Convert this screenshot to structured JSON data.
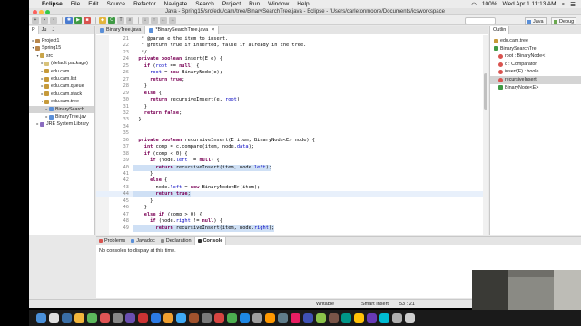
{
  "menubar": {
    "app": "Eclipse",
    "items": [
      "File",
      "Edit",
      "Source",
      "Refactor",
      "Navigate",
      "Search",
      "Project",
      "Run",
      "Window",
      "Help"
    ],
    "battery": "100%",
    "clock": "Wed Apr 1  11:13 AM"
  },
  "window": {
    "title": "Java - Spring15/src/edu/cam/tree/BinarySearchTree.java - Eclipse - /Users/carletonmoore/Documents/icsworkspace"
  },
  "perspectives": [
    "Java",
    "Debug"
  ],
  "explorer": {
    "tabs": [
      "P",
      "Ju",
      "J"
    ],
    "tree": [
      {
        "label": "Project1",
        "depth": 0,
        "icon": "project-icon",
        "color": "#b8864b",
        "twisty": "▸"
      },
      {
        "label": "Spring15",
        "depth": 0,
        "icon": "project-icon",
        "color": "#b8864b",
        "twisty": "▾"
      },
      {
        "label": "src",
        "depth": 1,
        "icon": "source-folder-icon",
        "color": "#c9a54a",
        "twisty": "▾"
      },
      {
        "label": "(default package)",
        "depth": 2,
        "icon": "package-icon",
        "color": "#d8c27a",
        "twisty": "▸"
      },
      {
        "label": "edu.cam",
        "depth": 2,
        "icon": "package-icon",
        "color": "#c69a3a",
        "twisty": "▸"
      },
      {
        "label": "edu.cam.list",
        "depth": 2,
        "icon": "package-icon",
        "color": "#c69a3a",
        "twisty": "▸"
      },
      {
        "label": "edu.cam.queue",
        "depth": 2,
        "icon": "package-icon",
        "color": "#c69a3a",
        "twisty": "▸"
      },
      {
        "label": "edu.cam.stack",
        "depth": 2,
        "icon": "package-icon",
        "color": "#c69a3a",
        "twisty": "▸"
      },
      {
        "label": "edu.cam.tree",
        "depth": 2,
        "icon": "package-icon",
        "color": "#c69a3a",
        "twisty": "▾"
      },
      {
        "label": "BinarySearch",
        "depth": 3,
        "icon": "java-file-icon",
        "color": "#5a8fd8",
        "twisty": "▸",
        "selected": true
      },
      {
        "label": "BinaryTree.jav",
        "depth": 3,
        "icon": "java-file-icon",
        "color": "#5a8fd8",
        "twisty": "▸"
      },
      {
        "label": "JRE System Library",
        "depth": 1,
        "icon": "library-icon",
        "color": "#8a6cc0",
        "twisty": "▸"
      }
    ]
  },
  "editor": {
    "tabs": [
      {
        "label": "BinaryTree.java",
        "active": false
      },
      {
        "label": "*BinarySearchTree.java",
        "active": true
      }
    ],
    "lines": [
      {
        "n": "21",
        "t": "   * @param e the item to insert.",
        "style": "cm"
      },
      {
        "n": "22",
        "t": "   * @return true if inserted, false if already in the tree.",
        "style": "cm"
      },
      {
        "n": "23",
        "t": "   */",
        "style": "cm"
      },
      {
        "n": "24",
        "t": "  private boolean insert(E e) {",
        "style": "code"
      },
      {
        "n": "25",
        "t": "    if (root == null) {",
        "style": "code"
      },
      {
        "n": "26",
        "t": "      root = new BinaryNode(e);",
        "style": "code"
      },
      {
        "n": "27",
        "t": "      return true;",
        "style": "code"
      },
      {
        "n": "28",
        "t": "    }",
        "style": "code"
      },
      {
        "n": "29",
        "t": "    else {",
        "style": "code"
      },
      {
        "n": "30",
        "t": "      return recursiveInsert(e, root);",
        "style": "code"
      },
      {
        "n": "31",
        "t": "    }",
        "style": "code"
      },
      {
        "n": "32",
        "t": "    return false;",
        "style": "code"
      },
      {
        "n": "33",
        "t": "  }",
        "style": "code"
      },
      {
        "n": "34",
        "t": "",
        "style": "code"
      },
      {
        "n": "35",
        "t": "",
        "style": "code"
      },
      {
        "n": "36",
        "t": "  private boolean recursiveInsert(E item, BinaryNode<E> node) {",
        "style": "code"
      },
      {
        "n": "37",
        "t": "    int comp = c.compare(item, node.data);",
        "style": "code"
      },
      {
        "n": "38",
        "t": "    if (comp < 0) {",
        "style": "code"
      },
      {
        "n": "39",
        "t": "      if (node.left != null) {",
        "style": "code"
      },
      {
        "n": "40",
        "t": "        return recursiveInsert(item, node.left);",
        "style": "hl"
      },
      {
        "n": "41",
        "t": "      }",
        "style": "code"
      },
      {
        "n": "42",
        "t": "      else {",
        "style": "code"
      },
      {
        "n": "43",
        "t": "        node.left = new BinaryNode<E>(item);",
        "style": "code"
      },
      {
        "n": "44",
        "t": "        return true;",
        "style": "hl"
      },
      {
        "n": "45",
        "t": "      }",
        "style": "code"
      },
      {
        "n": "46",
        "t": "    }",
        "style": "code"
      },
      {
        "n": "47",
        "t": "    else if (comp > 0) {",
        "style": "code"
      },
      {
        "n": "48",
        "t": "      if (node.right != null) {",
        "style": "code"
      },
      {
        "n": "49",
        "t": "        return recursiveInsert(item, node.right);",
        "style": "hl"
      }
    ]
  },
  "outline": {
    "tab": "Outlin",
    "items": [
      {
        "label": "edu.cam.tree",
        "icon": "package-icon",
        "color": "#c69a3a",
        "indent": 0
      },
      {
        "label": "BinarySearchTre",
        "icon": "class-icon",
        "color": "#3f9a44",
        "indent": 0
      },
      {
        "label": "root : BinaryNode<",
        "icon": "field-icon",
        "color": "#d9534f",
        "indent": 1
      },
      {
        "label": "c : Comparator",
        "icon": "field-icon",
        "color": "#d9534f",
        "indent": 1
      },
      {
        "label": "insert(E) : boole",
        "icon": "method-icon",
        "color": "#d9534f",
        "indent": 1
      },
      {
        "label": "recursiveInsert",
        "icon": "method-icon",
        "color": "#d9534f",
        "indent": 1,
        "selected": true
      },
      {
        "label": "BinaryNode<E>",
        "icon": "class-icon",
        "color": "#3f9a44",
        "indent": 1
      }
    ]
  },
  "bottom": {
    "tabs": [
      {
        "label": "Problems",
        "color": "#d9534f"
      },
      {
        "label": "Javadoc",
        "color": "#5a8fd8"
      },
      {
        "label": "Declaration",
        "color": "#8a8a8a"
      },
      {
        "label": "Console",
        "color": "#333333",
        "active": true
      }
    ],
    "message": "No consoles to display at this time."
  },
  "status": {
    "mode": "Writable",
    "insert": "Smart Insert",
    "position": "53 : 21"
  },
  "dock": {
    "colors": [
      "#4a90d9",
      "#e0e0e0",
      "#3a6ea5",
      "#f2b63c",
      "#5cb85c",
      "#e05555",
      "#888888",
      "#6a4fb0",
      "#cc3333",
      "#2c7be5",
      "#f0a030",
      "#3fa9f5",
      "#a0522d",
      "#7a7a7a",
      "#d64541",
      "#4caf50",
      "#1e88e5",
      "#9e9e9e",
      "#ff9800",
      "#607d8b",
      "#e91e63",
      "#3f51b5",
      "#8bc34a",
      "#795548",
      "#009688",
      "#ffc107",
      "#673ab7",
      "#00bcd4",
      "#b0b0b0",
      "#cfcfcf"
    ]
  }
}
